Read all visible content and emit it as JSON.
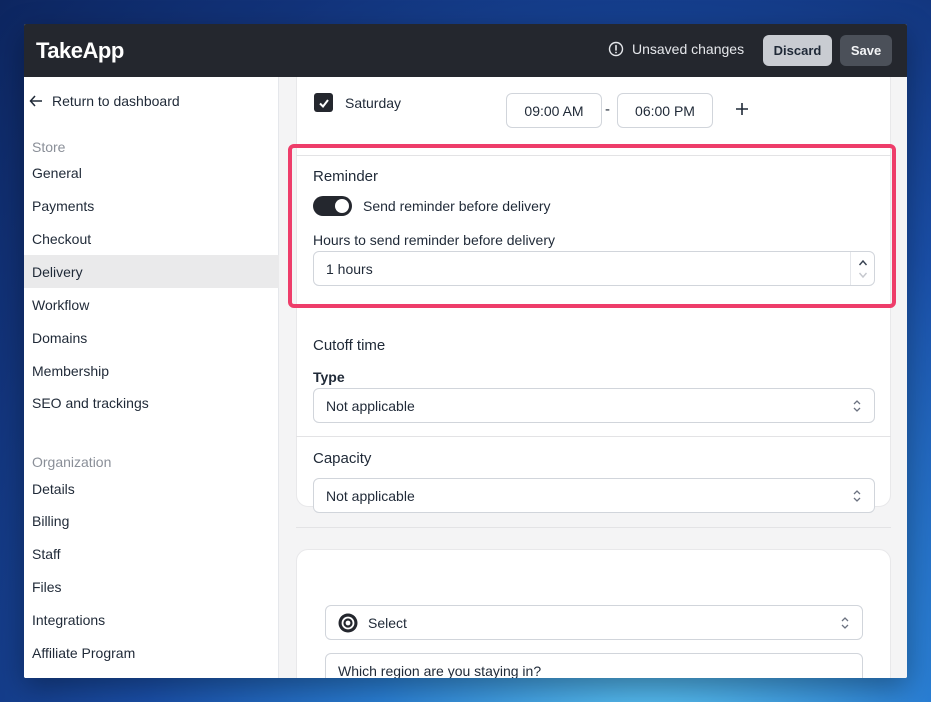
{
  "app": {
    "title": "TakeApp"
  },
  "header": {
    "unsaved_text": "Unsaved changes",
    "discard_label": "Discard",
    "save_label": "Save"
  },
  "sidebar": {
    "back_label": "Return to dashboard",
    "store_label": "Store",
    "store_items": [
      {
        "label": "General"
      },
      {
        "label": "Payments"
      },
      {
        "label": "Checkout"
      },
      {
        "label": "Delivery",
        "active": true
      },
      {
        "label": "Workflow"
      },
      {
        "label": "Domains"
      },
      {
        "label": "Membership"
      },
      {
        "label": "SEO and trackings"
      }
    ],
    "org_label": "Organization",
    "org_items": [
      {
        "label": "Details"
      },
      {
        "label": "Billing"
      },
      {
        "label": "Staff"
      },
      {
        "label": "Files"
      },
      {
        "label": "Integrations"
      },
      {
        "label": "Affiliate Program"
      }
    ]
  },
  "schedule": {
    "day": "Saturday",
    "checked": true,
    "start_time": "09:00 AM",
    "end_time": "06:00 PM",
    "separator": "-"
  },
  "reminder": {
    "title": "Reminder",
    "toggle_label": "Send reminder before delivery",
    "toggle_on": true,
    "hours_label": "Hours to send reminder before delivery",
    "hours_value": "1 hours"
  },
  "cutoff": {
    "title": "Cutoff time",
    "type_label": "Type",
    "type_value": "Not applicable"
  },
  "capacity": {
    "title": "Capacity",
    "value": "Not applicable"
  },
  "question": {
    "select_value": "Select",
    "question_text": "Which region are you staying in?"
  },
  "colors": {
    "topbar": "#24272e",
    "highlight": "#ee3d6a",
    "toggle_on": "#24272e"
  }
}
